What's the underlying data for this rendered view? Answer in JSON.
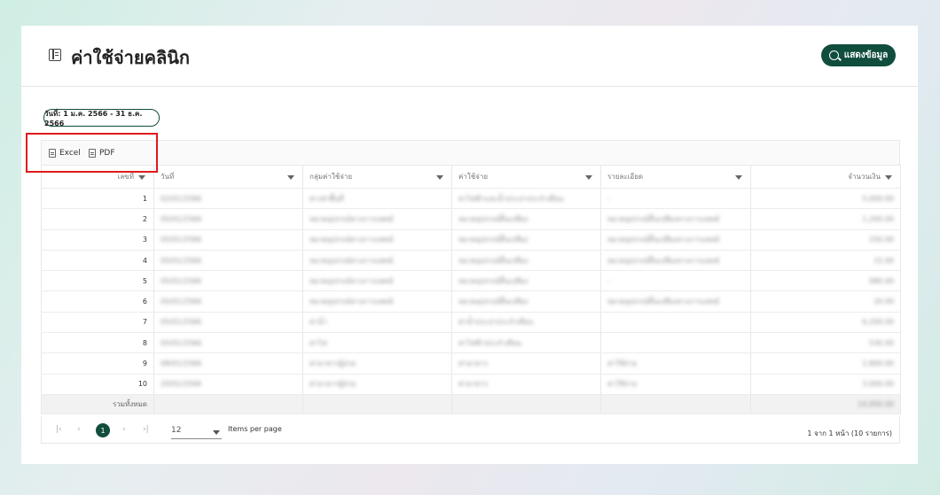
{
  "header": {
    "title": "ค่าใช้จ่ายคลินิก",
    "show_button_label": "แสดงข้อมูล"
  },
  "filter": {
    "date_range": "วันที่: 1 ม.ค. 2566 - 31 ธ.ค. 2566"
  },
  "toolbar": {
    "excel_label": "Excel",
    "pdf_label": "PDF"
  },
  "table": {
    "columns": [
      "เลขที่",
      "วันที่",
      "กลุ่มค่าใช้จ่าย",
      "ค่าใช้จ่าย",
      "รายละเอียด",
      "จำนวนเงิน"
    ],
    "rows": [
      {
        "no": "1",
        "date": "02/01/2566",
        "group": "ค่าเช่าพื้นที่",
        "expense": "ค่าไฟฟ้าและน้ำประปาประจำเดือน",
        "detail": "-",
        "amount": "5,000.00"
      },
      {
        "no": "2",
        "date": "05/01/2566",
        "group": "หมวดอุปกรณ์ทางการแพทย์",
        "expense": "หมวดอุปกรณ์สิ้นเปลือง",
        "detail": "หมวดอุปกรณ์สิ้นเปลืองทางการแพทย์",
        "amount": "1,200.00"
      },
      {
        "no": "3",
        "date": "05/01/2566",
        "group": "หมวดอุปกรณ์ทางการแพทย์",
        "expense": "หมวดอุปกรณ์สิ้นเปลือง",
        "detail": "หมวดอุปกรณ์สิ้นเปลืองทางการแพทย์",
        "amount": "250.00"
      },
      {
        "no": "4",
        "date": "05/01/2566",
        "group": "หมวดอุปกรณ์ทางการแพทย์",
        "expense": "หมวดอุปกรณ์สิ้นเปลือง",
        "detail": "หมวดอุปกรณ์สิ้นเปลืองทางการแพทย์",
        "amount": "15.00"
      },
      {
        "no": "5",
        "date": "05/01/2566",
        "group": "หมวดอุปกรณ์ทางการแพทย์",
        "expense": "หมวดอุปกรณ์สิ้นเปลือง",
        "detail": "-",
        "amount": "980.00"
      },
      {
        "no": "6",
        "date": "05/01/2566",
        "group": "หมวดอุปกรณ์ทางการแพทย์",
        "expense": "หมวดอุปกรณ์สิ้นเปลือง",
        "detail": "หมวดอุปกรณ์สิ้นเปลืองทางการแพทย์",
        "amount": "20.00"
      },
      {
        "no": "7",
        "date": "05/01/2566",
        "group": "ค่าน้ำ",
        "expense": "ค่าน้ำประปาประจำเดือน",
        "detail": "",
        "amount": "6,200.00"
      },
      {
        "no": "8",
        "date": "05/01/2566",
        "group": "ค่าไฟ",
        "expense": "ค่าไฟฟ้าประจำเดือน",
        "detail": "",
        "amount": "530.00"
      },
      {
        "no": "9",
        "date": "08/01/2566",
        "group": "ค่าอาหารผู้ป่วย",
        "expense": "ค่าอาหาร",
        "detail": "ค่าใช้จ่าย",
        "amount": "2,800.00"
      },
      {
        "no": "10",
        "date": "20/01/2566",
        "group": "ค่าอาหารผู้ป่วย",
        "expense": "ค่าอาหาร",
        "detail": "ค่าใช้จ่าย",
        "amount": "3,000.00"
      }
    ],
    "total_label": "รวมทั้งหมด",
    "total_amount": "14,950.00"
  },
  "pager": {
    "first": "|‹",
    "prev": "‹",
    "current": "1",
    "next": "›",
    "last": "›|",
    "page_size": "12",
    "items_per_page_label": "Items per page",
    "info": "1 จาก 1 หน้า (10 รายการ)"
  },
  "colors": {
    "accent": "#104d3d",
    "highlight": "#e0191c"
  }
}
